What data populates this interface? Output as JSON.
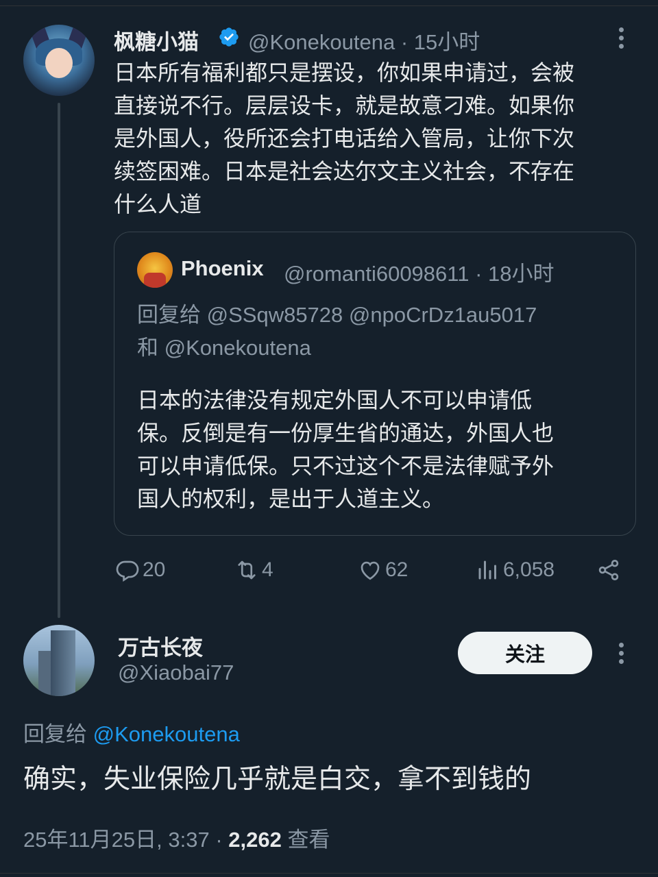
{
  "tweet": {
    "author_name": "枫糖小猫",
    "handle": "@Konekoutena",
    "separator": "·",
    "time": "15小时",
    "text_lines": [
      "日本所有福利都只是摆设，你如果申请过，会被",
      "直接说不行。层层设卡，就是故意刁难。如果你",
      "是外国人，役所还会打电话给入管局，让你下次",
      "续签困难。日本是社会达尔文主义社会，不存在",
      "什么人道"
    ],
    "quote": {
      "author_name": "Phoenix",
      "handle": "@romanti60098611",
      "time": "18小时",
      "reply_prefix": "回复给",
      "reply_to_1": "@SSqw85728",
      "reply_to_2": "@npoCrDz1au5017",
      "reply_and": "和",
      "reply_to_3": "@Konekoutena",
      "text_lines": [
        "日本的法律没有规定外国人不可以申请低",
        "保。反倒是有一份厚生省的通达，外国人也",
        "可以申请低保。只不过这个不是法律赋予外",
        "国人的权利，是出于人道主义。"
      ]
    },
    "stats": {
      "replies": "20",
      "retweets": "4",
      "likes": "62",
      "views": "6,058"
    }
  },
  "reply": {
    "author_name": "万古长夜",
    "handle": "@Xiaobai77",
    "follow_label": "关注",
    "reply_prefix": "回复给",
    "reply_to": "@Konekoutena",
    "text": "确实，失业保险几乎就是白交，拿不到钱的",
    "date": "25年11月25日, 3:37",
    "separator": "·",
    "views": "2,262",
    "views_label": "查看"
  },
  "icons": {
    "verified": "verified-badge-icon",
    "more": "more-dots-icon",
    "reply": "comment-icon",
    "retweet": "retweet-icon",
    "like": "heart-icon",
    "views": "analytics-icon",
    "share": "share-icon"
  },
  "colors": {
    "background": "#15202b",
    "text": "#e7e9ea",
    "secondary": "#8b98a5",
    "link": "#1d9bf0",
    "verified": "#1d9bf0"
  }
}
